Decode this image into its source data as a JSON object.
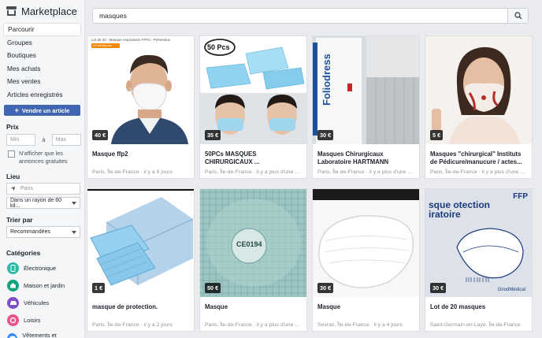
{
  "app": {
    "title": "Marketplace"
  },
  "nav": [
    {
      "label": "Parcourir",
      "active": true
    },
    {
      "label": "Groupes"
    },
    {
      "label": "Boutiques"
    },
    {
      "label": "Mes achats"
    },
    {
      "label": "Mes ventes"
    },
    {
      "label": "Articles enregistrés"
    }
  ],
  "sell_button": "Vendre un article",
  "filters": {
    "price_title": "Prix",
    "min_placeholder": "Min.",
    "price_separator": "à",
    "max_placeholder": "Max",
    "free_only_label": "N'afficher que les annonces gratuites",
    "location_title": "Lieu",
    "location_value": "Paris",
    "radius_value": "Dans un rayon de 60 kil...",
    "sort_title": "Trier par",
    "sort_value": "Recommandées"
  },
  "categories": {
    "title": "Catégories",
    "items": [
      {
        "label": "Électronique",
        "color": "#2abba7",
        "icon": "phone-icon"
      },
      {
        "label": "Maison et jardin",
        "color": "#0fa37f",
        "icon": "house-icon"
      },
      {
        "label": "Véhicules",
        "color": "#7b4fc5",
        "icon": "car-icon"
      },
      {
        "label": "Loisirs",
        "color": "#e9528a",
        "icon": "hobby-icon"
      },
      {
        "label": "Vêtements et accessoires",
        "color": "#2d88ff",
        "icon": "clothes-icon"
      }
    ]
  },
  "search": {
    "query": "masques"
  },
  "listings": [
    {
      "price": "40 €",
      "title": "Masque ffp2",
      "location": "Paris, Île-de-France · il y a 6 jours",
      "thumb": "man-mask"
    },
    {
      "price": "35 €",
      "title": "50PCs MASQUES CHIRURGICAUX ...",
      "location": "Paris, Île-de-France · il y a plus d'une s...",
      "thumb": "surgical-pack"
    },
    {
      "price": "30 €",
      "title": "Masques Chirurgicaux Laboratoire HARTMANN",
      "location": "Paris, Île-de-France · il y a plus d'une s...",
      "thumb": "hartmann-box"
    },
    {
      "price": "5 €",
      "title": "Masques \"chirurgical\" Instituts de Pédicure/manucure / actes...",
      "location": "Paris, Île-de-France · il y a plus d'une s...",
      "thumb": "woman-mask"
    },
    {
      "price": "1 €",
      "title": "masque de protection.",
      "location": "Paris, Île-de-France · il y a 2 jours",
      "thumb": "blue-box"
    },
    {
      "price": "50 €",
      "title": "Masque",
      "location": "Paris, Île-de-France · il y a plus d'une s...",
      "thumb": "ffp2-closeup"
    },
    {
      "price": "30 €",
      "title": "Masque",
      "location": "Sevran, Île-de-France · il y a 4 jours",
      "thumb": "white-mask"
    },
    {
      "price": "30 €",
      "title": "Lot de 20 masques",
      "location": "Saint-Germain-en-Laye, Île-de-France",
      "thumb": "ffp2-package"
    }
  ],
  "thumb_text": {
    "pack_count": "50 Pcs",
    "box_brand": "Foliodress",
    "ffp2_code": "CE0194",
    "package_text": "sque otection iratoire",
    "package_class": "FFP",
    "package_brand": "GirodMédical",
    "promo_line": "Lot de 20 - Masque respiratoire FFP2 - Prévention",
    "promo_badge": "#1 Meilleures ventes"
  },
  "colors": {
    "accent": "#4267b2",
    "background": "#e9ebee"
  }
}
